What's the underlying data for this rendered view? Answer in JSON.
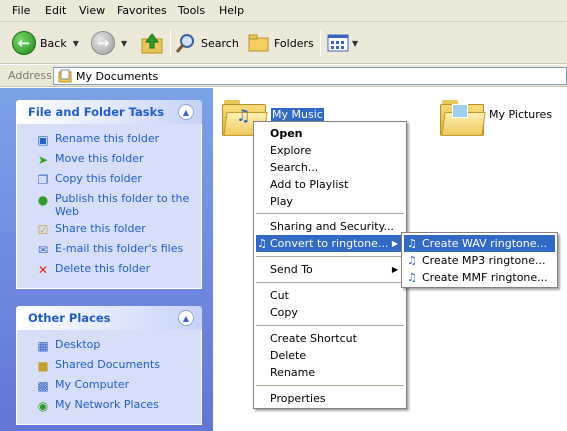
{
  "menubar": {
    "items": [
      "File",
      "Edit",
      "View",
      "Favorites",
      "Tools",
      "Help"
    ]
  },
  "toolbar": {
    "back_label": "Back",
    "search_label": "Search",
    "folders_label": "Folders"
  },
  "address": {
    "label": "Address",
    "value": "My Documents"
  },
  "tasks_panel": {
    "title": "File and Folder Tasks",
    "items": [
      "Rename this folder",
      "Move this folder",
      "Copy this folder",
      "Publish this folder to the Web",
      "Share this folder",
      "E-mail this folder's files",
      "Delete this folder"
    ]
  },
  "places_panel": {
    "title": "Other Places",
    "items": [
      "Desktop",
      "Shared Documents",
      "My Computer",
      "My Network Places"
    ]
  },
  "folders": [
    {
      "label": "My Music"
    },
    {
      "label": "My Pictures"
    }
  ],
  "context_menu": {
    "items": [
      "Open",
      "Explore",
      "Search...",
      "Add to Playlist",
      "Play",
      "Sharing and Security...",
      "Convert to ringtone...",
      "Send To",
      "Cut",
      "Copy",
      "Create Shortcut",
      "Delete",
      "Rename",
      "Properties"
    ]
  },
  "submenu": {
    "items": [
      "Create WAV ringtone...",
      "Create MP3 ringtone...",
      "Create MMF ringtone..."
    ]
  },
  "colors": {
    "selection": "#316AC5",
    "task_link": "#215dc6",
    "pane_gradient_top": "#7ba2e7",
    "pane_gradient_bottom": "#6375d6"
  }
}
